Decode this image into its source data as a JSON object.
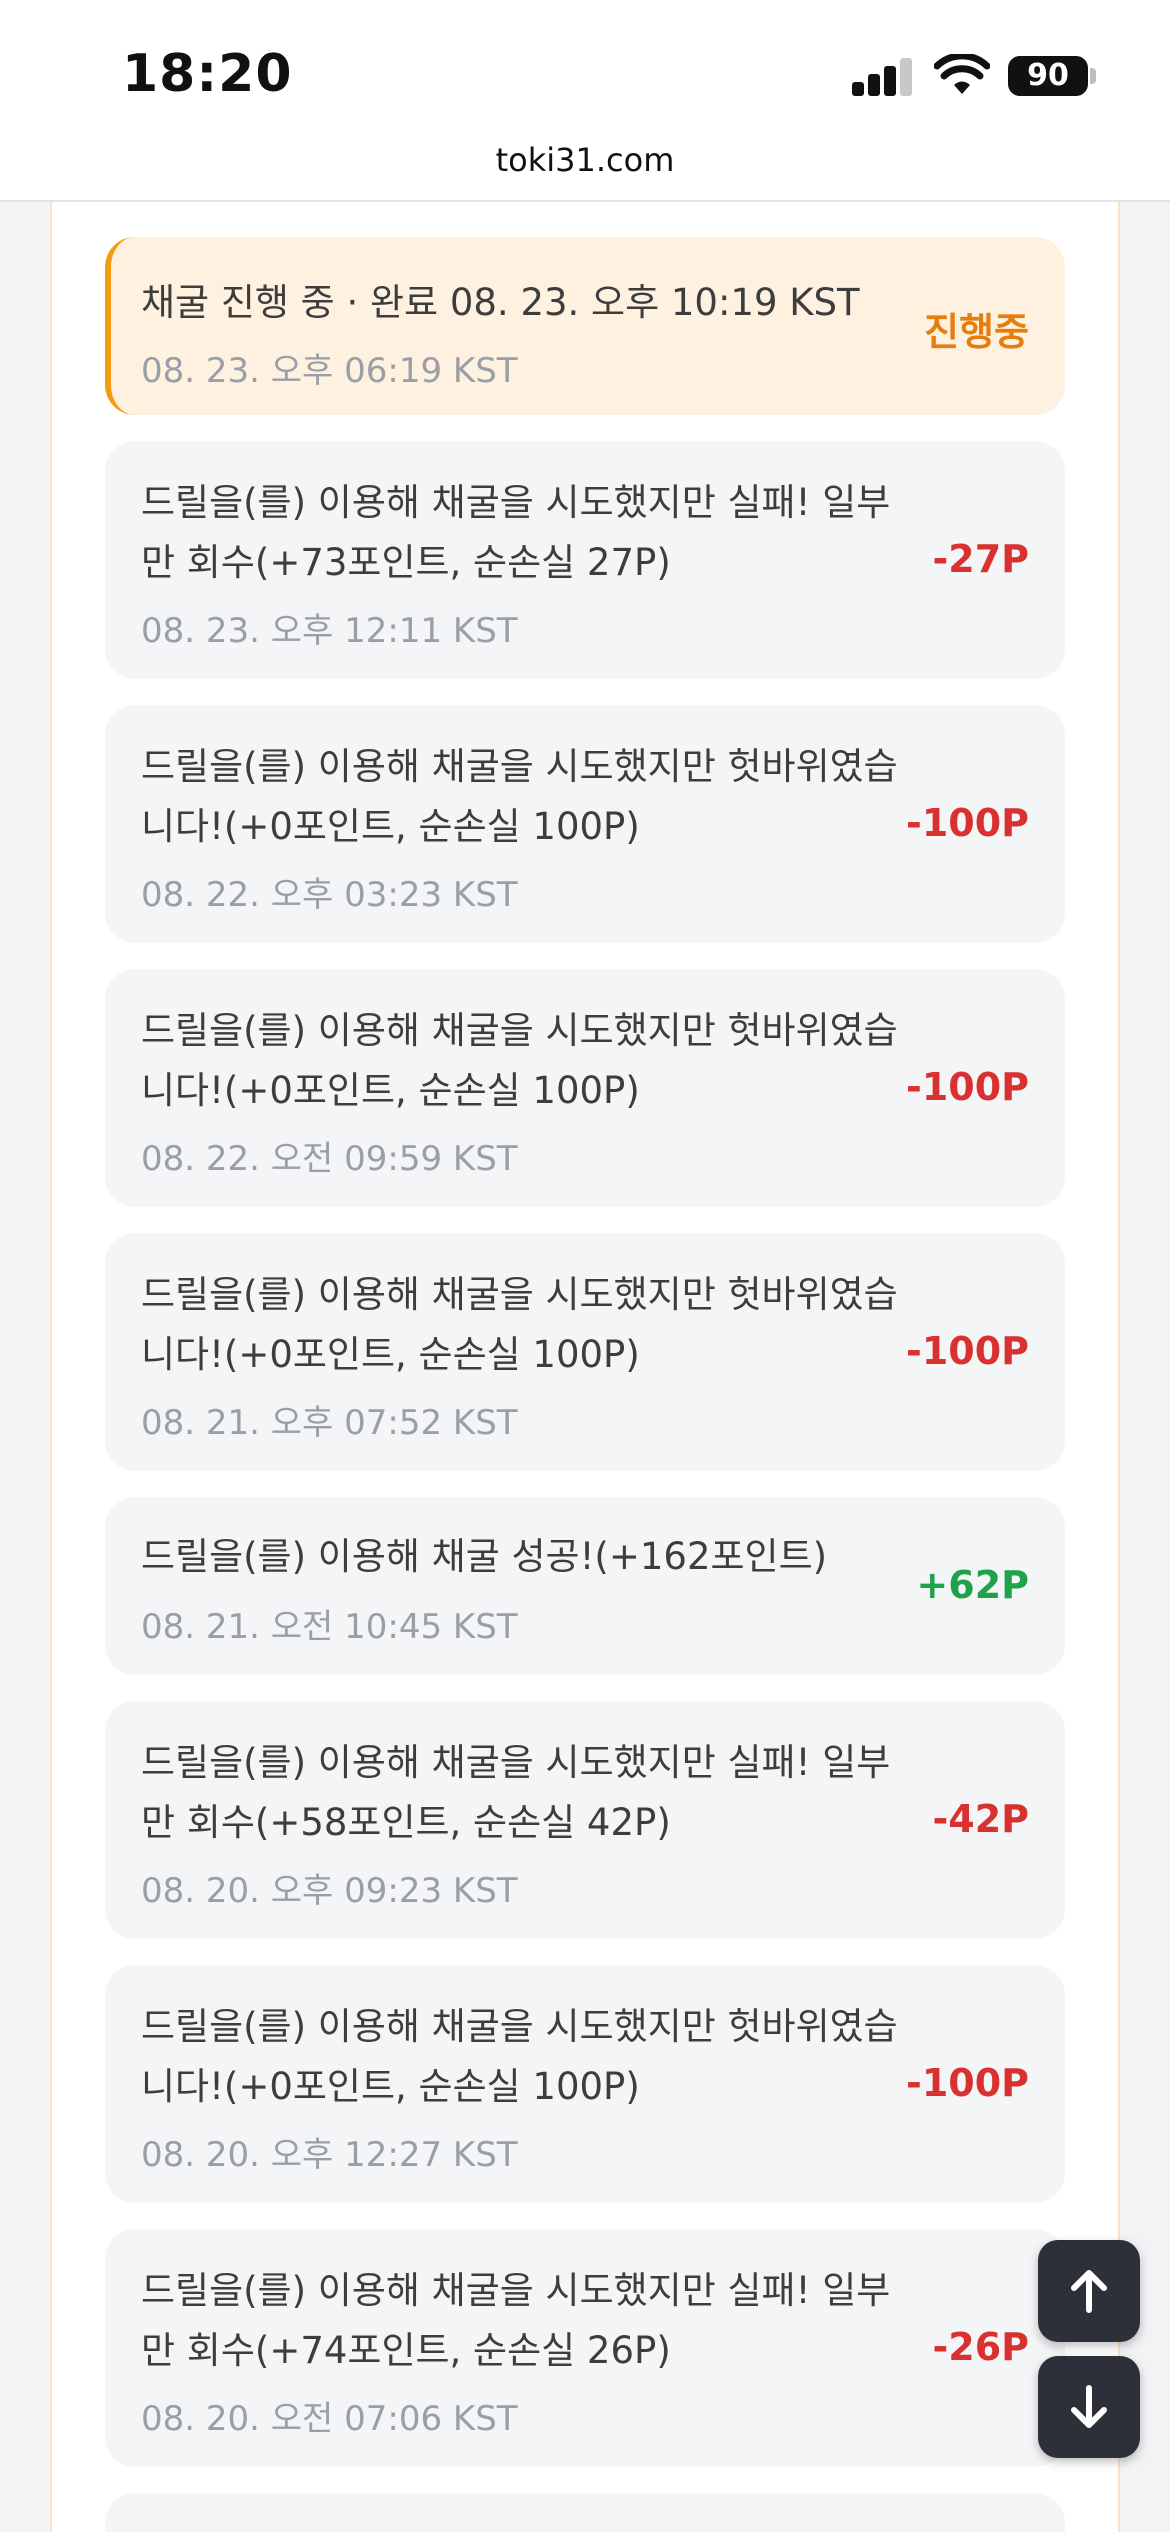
{
  "status_bar": {
    "time": "18:20",
    "battery": "90"
  },
  "browser": {
    "url": "toki31.com"
  },
  "history": [
    {
      "title": "채굴 진행 중 · 완료 08. 23. 오후 10:19 KST",
      "date": "08. 23. 오후 06:19 KST",
      "amount": "진행중",
      "status": "in-progress"
    },
    {
      "title": "드릴을(를) 이용해 채굴을 시도했지만 실패! 일부만 회수(+73포인트, 순손실 27P)",
      "date": "08. 23. 오후 12:11 KST",
      "amount": "-27P",
      "status": "loss"
    },
    {
      "title": "드릴을(를) 이용해 채굴을 시도했지만 헛바위였습니다!(+0포인트, 순손실 100P)",
      "date": "08. 22. 오후 03:23 KST",
      "amount": "-100P",
      "status": "loss"
    },
    {
      "title": "드릴을(를) 이용해 채굴을 시도했지만 헛바위였습니다!(+0포인트, 순손실 100P)",
      "date": "08. 22. 오전 09:59 KST",
      "amount": "-100P",
      "status": "loss"
    },
    {
      "title": "드릴을(를) 이용해 채굴을 시도했지만 헛바위였습니다!(+0포인트, 순손실 100P)",
      "date": "08. 21. 오후 07:52 KST",
      "amount": "-100P",
      "status": "loss"
    },
    {
      "title": "드릴을(를) 이용해 채굴 성공!(+162포인트)",
      "date": "08. 21. 오전 10:45 KST",
      "amount": "+62P",
      "status": "gain"
    },
    {
      "title": "드릴을(를) 이용해 채굴을 시도했지만 실패! 일부만 회수(+58포인트, 순손실 42P)",
      "date": "08. 20. 오후 09:23 KST",
      "amount": "-42P",
      "status": "loss"
    },
    {
      "title": "드릴을(를) 이용해 채굴을 시도했지만 헛바위였습니다!(+0포인트, 순손실 100P)",
      "date": "08. 20. 오후 12:27 KST",
      "amount": "-100P",
      "status": "loss"
    },
    {
      "title": "드릴을(를) 이용해 채굴을 시도했지만 실패! 일부만 회수(+74포인트, 순손실 26P)",
      "date": "08. 20. 오전 07:06 KST",
      "amount": "-26P",
      "status": "loss"
    }
  ],
  "icons": {
    "scroll_up": "arrow-up-icon",
    "scroll_down": "arrow-down-icon"
  },
  "colors": {
    "loss": "#d93030",
    "gain": "#1fa34a",
    "in_progress": "#e67e0f",
    "accent": "#f39c12"
  }
}
